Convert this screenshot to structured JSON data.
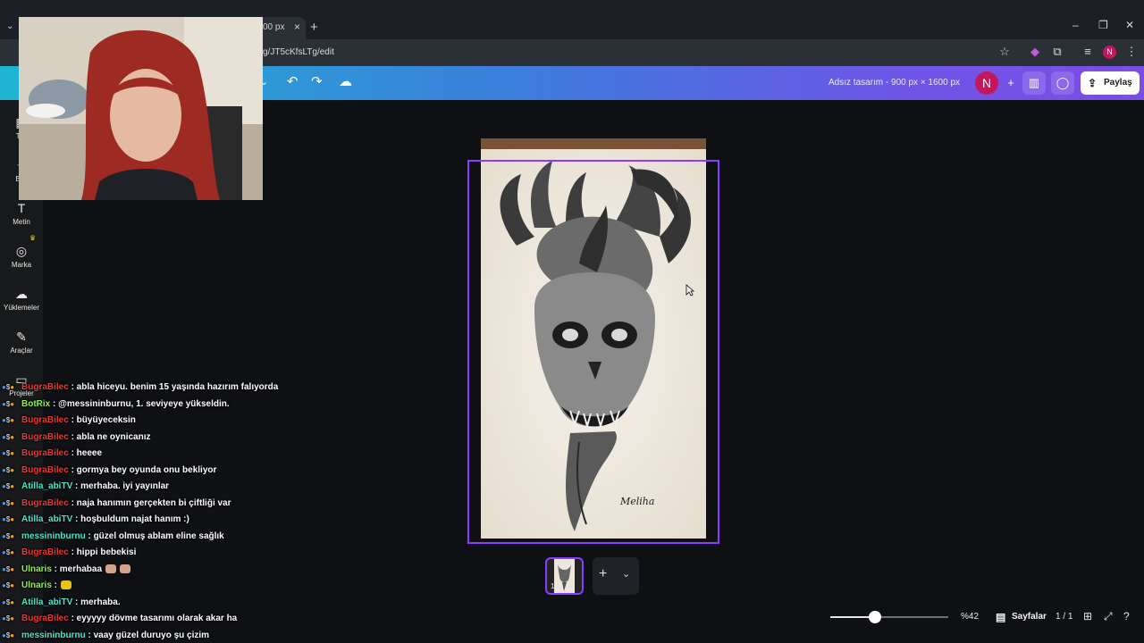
{
  "browser": {
    "tab_title": "00 px",
    "tab_close": "×",
    "new_tab": "+",
    "url": "g/JT5cKfsLTg/edit",
    "profile_initial": "N",
    "window_controls": [
      "–",
      "❐",
      "✕"
    ]
  },
  "header": {
    "doc_title": "Adsız tasarım - 900 px × 1600 px",
    "user_initial": "N",
    "share_label": "Paylaş"
  },
  "sidebar": {
    "items": [
      {
        "label": "Tas",
        "icon": "template-icon"
      },
      {
        "label": "Bile",
        "icon": "elements-icon"
      },
      {
        "label": "Metin",
        "icon": "text-icon"
      },
      {
        "label": "Marka",
        "icon": "brand-icon"
      },
      {
        "label": "Yüklemeler",
        "icon": "upload-icon"
      },
      {
        "label": "Araçlar",
        "icon": "pen-icon"
      },
      {
        "label": "Projeler",
        "icon": "folder-icon"
      }
    ]
  },
  "canvas": {
    "page_number": "1",
    "signature": "Meliha"
  },
  "bottom_bar": {
    "zoom": "%42",
    "zoom_level": 0.38,
    "pages_label": "Sayfalar",
    "page_count": "1 / 1"
  },
  "chat": [
    {
      "user": "BugraBilec",
      "color": "#e23a3a",
      "message": ": abla hiceyu. benim 15 yaşında hazırım falıyorda",
      "emotes": 0
    },
    {
      "user": "BotRix",
      "color": "#8ef04a",
      "message": ": @messininburnu, 1. seviyeye yükseldin.",
      "emotes": 0
    },
    {
      "user": "BugraBilec",
      "color": "#e23a3a",
      "message": ": büyüyeceksin",
      "emotes": 0
    },
    {
      "user": "BugraBilec",
      "color": "#e23a3a",
      "message": ": abla ne oynicanız",
      "emotes": 0
    },
    {
      "user": "BugraBilec",
      "color": "#e23a3a",
      "message": ": heeee",
      "emotes": 0
    },
    {
      "user": "BugraBilec",
      "color": "#e23a3a",
      "message": ": gormya bey oyunda onu bekliyor",
      "emotes": 0
    },
    {
      "user": "Atilla_abiTV",
      "color": "#4fe3c6",
      "message": ": merhaba. iyi yayınlar",
      "emotes": 0
    },
    {
      "user": "BugraBilec",
      "color": "#e23a3a",
      "message": ": naja hanımın gerçekten bi çiftliği var",
      "emotes": 0
    },
    {
      "user": "Atilla_abiTV",
      "color": "#4fe3c6",
      "message": ": hoşbuldum najat hanım :)",
      "emotes": 0
    },
    {
      "user": "messininburnu",
      "color": "#4fe3c6",
      "message": ": güzel olmuş ablam eline sağlık",
      "emotes": 0
    },
    {
      "user": "BugraBilec",
      "color": "#e23a3a",
      "message": ": hippi bebekisi",
      "emotes": 0
    },
    {
      "user": "Ulnaris",
      "color": "#8ef04a",
      "message": ": merhabaa",
      "emotes": 2
    },
    {
      "user": "Ulnaris",
      "color": "#8ef04a",
      "message": ":",
      "emotes": 1
    },
    {
      "user": "Atilla_abiTV",
      "color": "#4fe3c6",
      "message": ": merhaba.",
      "emotes": 0
    },
    {
      "user": "BugraBilec",
      "color": "#e23a3a",
      "message": ": eyyyyy dövme tasarımı olarak akar ha",
      "emotes": 0
    },
    {
      "user": "messininburnu",
      "color": "#4fe3c6",
      "message": ": vaay güzel duruyo şu çizim",
      "emotes": 0
    }
  ]
}
